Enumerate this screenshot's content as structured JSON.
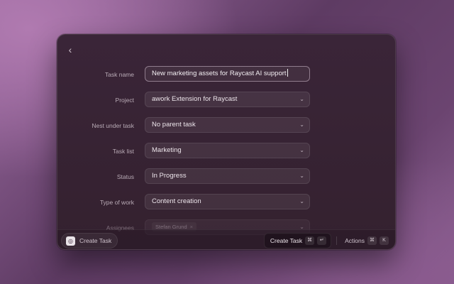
{
  "form": {
    "task_name": {
      "label": "Task name",
      "value": "New marketing assets for Raycast AI support"
    },
    "project": {
      "label": "Project",
      "value": "awork Extension for Raycast"
    },
    "nest_under_task": {
      "label": "Nest under task",
      "value": "No parent task"
    },
    "task_list": {
      "label": "Task list",
      "value": "Marketing"
    },
    "status": {
      "label": "Status",
      "value": "In Progress"
    },
    "type_of_work": {
      "label": "Type of work",
      "value": "Content creation"
    },
    "assignees": {
      "label": "Assignees",
      "tags": [
        "Stefan Grund"
      ]
    }
  },
  "icons": {
    "back": "chevron-left-icon",
    "dropdown": "chevron-down-icon",
    "app": "awork-app-icon"
  },
  "footer": {
    "left_label": "Create Task",
    "primary_action": {
      "label": "Create Task",
      "keys": [
        "⌘",
        "↵"
      ]
    },
    "actions": {
      "label": "Actions",
      "keys": [
        "⌘",
        "K"
      ]
    }
  },
  "colors": {
    "window_bg": "#3a2538",
    "text": "#ece4ea",
    "label": "#b9abb6"
  }
}
